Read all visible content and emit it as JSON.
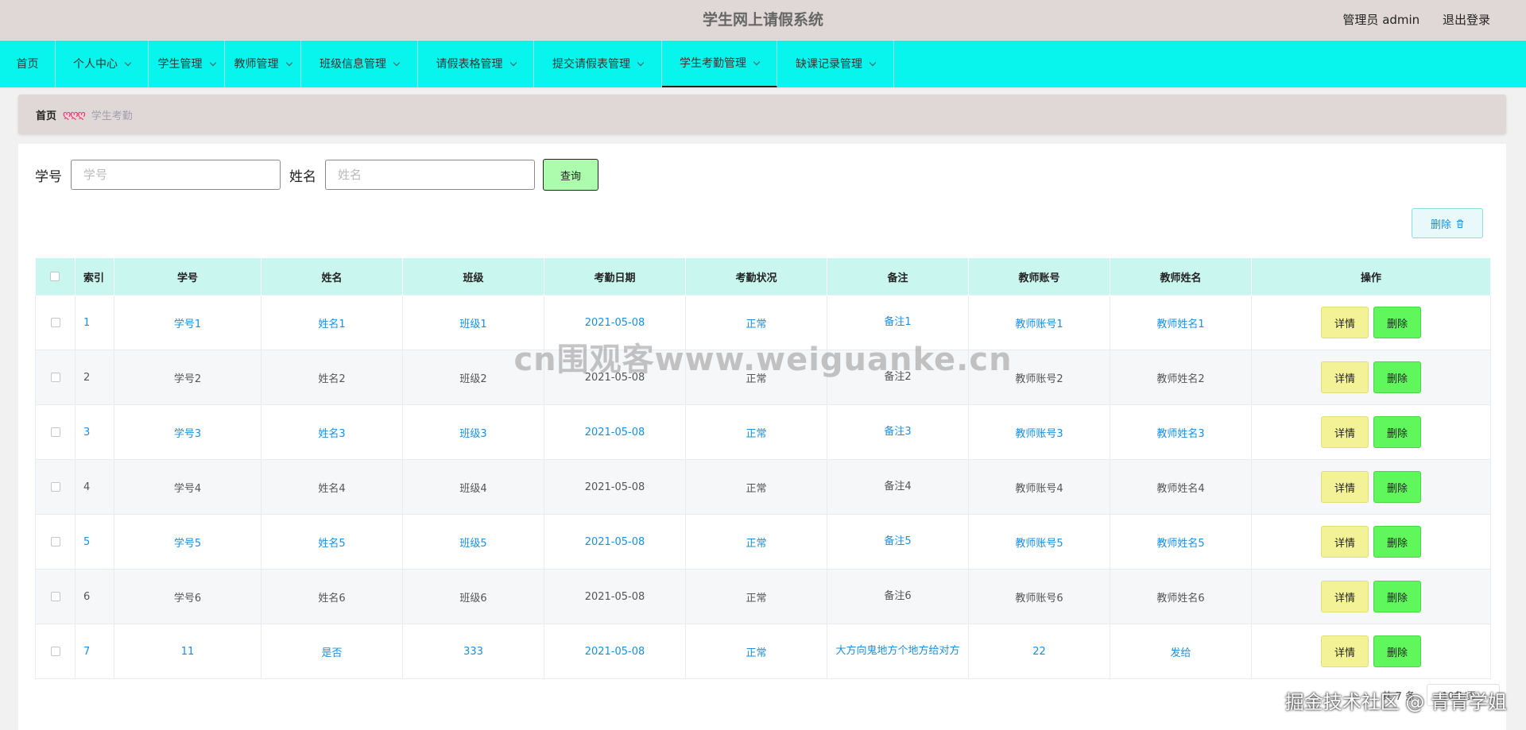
{
  "header": {
    "title": "学生网上请假系统",
    "user": "管理员 admin",
    "logout": "退出登录"
  },
  "nav": [
    {
      "label": "首页",
      "dropdown": false
    },
    {
      "label": "个人中心",
      "dropdown": true
    },
    {
      "label": "学生管理",
      "dropdown": true
    },
    {
      "label": "教师管理",
      "dropdown": true
    },
    {
      "label": "班级信息管理",
      "dropdown": true
    },
    {
      "label": "请假表格管理",
      "dropdown": true
    },
    {
      "label": "提交请假表管理",
      "dropdown": true
    },
    {
      "label": "学生考勤管理",
      "dropdown": true,
      "active": true
    },
    {
      "label": "缺课记录管理",
      "dropdown": true
    }
  ],
  "breadcrumb": {
    "home": "首页",
    "separator": "ღღღ",
    "current": "学生考勤"
  },
  "search": {
    "student_no_label": "学号",
    "student_no_placeholder": "学号",
    "name_label": "姓名",
    "name_placeholder": "姓名",
    "button": "查询"
  },
  "toolbar": {
    "delete_label": "删除"
  },
  "table": {
    "headers": [
      "索引",
      "学号",
      "姓名",
      "班级",
      "考勤日期",
      "考勤状况",
      "备注",
      "教师账号",
      "教师姓名",
      "操作"
    ],
    "rows": [
      [
        "1",
        "学号1",
        "姓名1",
        "班级1",
        "2021-05-08",
        "正常",
        "备注1",
        "教师账号1",
        "教师姓名1"
      ],
      [
        "2",
        "学号2",
        "姓名2",
        "班级2",
        "2021-05-08",
        "正常",
        "备注2",
        "教师账号2",
        "教师姓名2"
      ],
      [
        "3",
        "学号3",
        "姓名3",
        "班级3",
        "2021-05-08",
        "正常",
        "备注3",
        "教师账号3",
        "教师姓名3"
      ],
      [
        "4",
        "学号4",
        "姓名4",
        "班级4",
        "2021-05-08",
        "正常",
        "备注4",
        "教师账号4",
        "教师姓名4"
      ],
      [
        "5",
        "学号5",
        "姓名5",
        "班级5",
        "2021-05-08",
        "正常",
        "备注5",
        "教师账号5",
        "教师姓名5"
      ],
      [
        "6",
        "学号6",
        "姓名6",
        "班级6",
        "2021-05-08",
        "正常",
        "备注6",
        "教师账号6",
        "教师姓名6"
      ],
      [
        "7",
        "11",
        "是否",
        "333",
        "2021-05-08",
        "正常",
        "大方向鬼地方个地方给对方",
        "22",
        "发给"
      ]
    ],
    "detail_label": "详情",
    "delete_label": "删除"
  },
  "pagination": {
    "total": "共 7 条",
    "page_size": "10条/页"
  },
  "watermark": "cn围观客www.weiguanke.cn",
  "footer_watermark": "掘金技术社区 @ 青青学姐",
  "colors": {
    "nav_bg": "#07f5ec",
    "header_bg": "#e0d8d7",
    "link": "#1a8fe0",
    "detail_btn": "#f4f297",
    "delete_btn": "#5ff75c",
    "search_btn": "#adfcae"
  }
}
